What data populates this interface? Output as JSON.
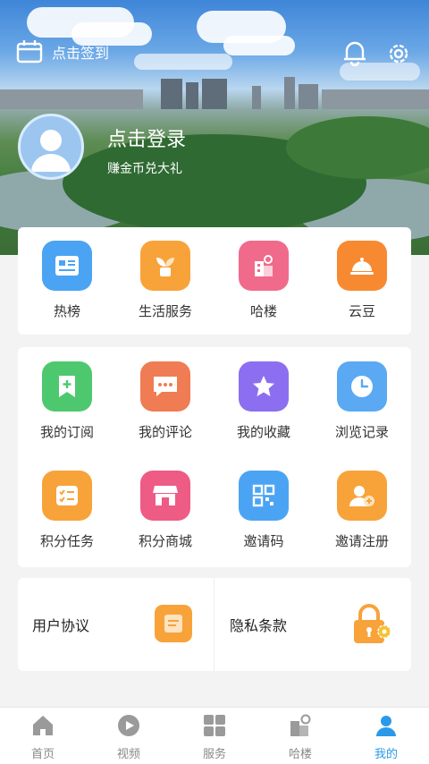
{
  "header": {
    "signin_label": "点击签到",
    "login_title": "点击登录",
    "login_subtitle": "赚金币兑大礼"
  },
  "quick_links": [
    {
      "label": "热榜",
      "icon": "hot-list-icon",
      "color": "#4ba4f3"
    },
    {
      "label": "生活服务",
      "icon": "plant-icon",
      "color": "#f7a33a"
    },
    {
      "label": "哈楼",
      "icon": "building-icon",
      "color": "#f06a8c"
    },
    {
      "label": "云豆",
      "icon": "food-cloche-icon",
      "color": "#f78a31"
    }
  ],
  "features": [
    {
      "label": "我的订阅",
      "icon": "subscribe-icon",
      "color": "#4ec86f"
    },
    {
      "label": "我的评论",
      "icon": "comment-icon",
      "color": "#f07c54"
    },
    {
      "label": "我的收藏",
      "icon": "star-icon",
      "color": "#8c6ff0"
    },
    {
      "label": "浏览记录",
      "icon": "clock-icon",
      "color": "#5aa9f2"
    },
    {
      "label": "积分任务",
      "icon": "task-list-icon",
      "color": "#f7a33a"
    },
    {
      "label": "积分商城",
      "icon": "store-icon",
      "color": "#ee5b84"
    },
    {
      "label": "邀请码",
      "icon": "qr-code-icon",
      "color": "#4ba4f3"
    },
    {
      "label": "邀请注册",
      "icon": "add-user-icon",
      "color": "#f7a33a"
    }
  ],
  "agreements": {
    "user_agreement": "用户协议",
    "privacy_policy": "隐私条款"
  },
  "tabs": [
    {
      "label": "首页"
    },
    {
      "label": "视频"
    },
    {
      "label": "服务"
    },
    {
      "label": "哈楼"
    },
    {
      "label": "我的"
    }
  ],
  "colors": {
    "accent": "#2a9ae8",
    "tab_inactive": "#9a9a9a"
  }
}
